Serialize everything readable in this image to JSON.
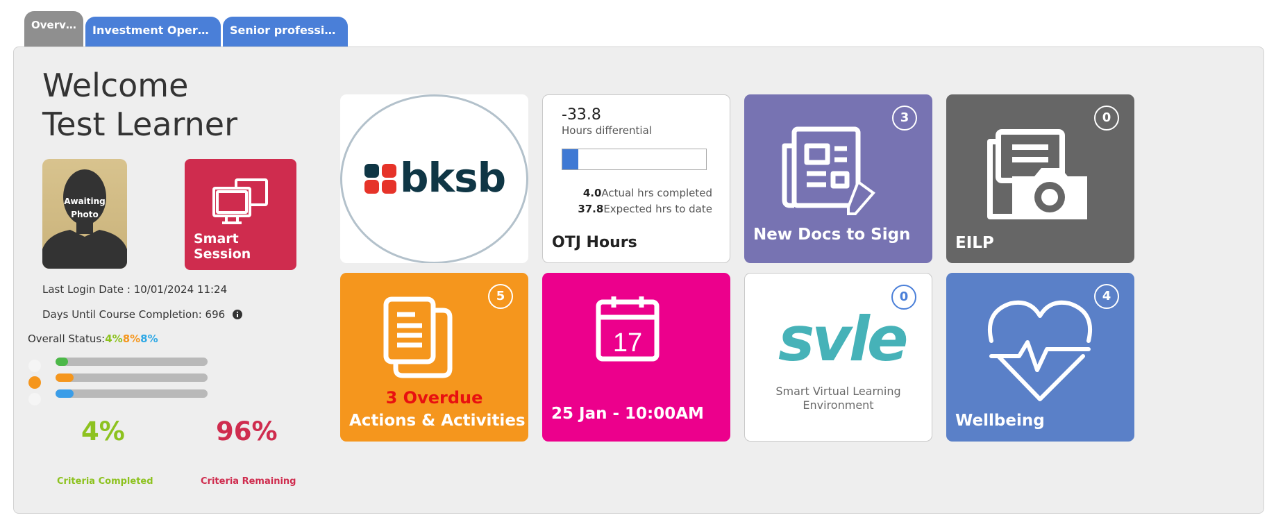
{
  "tabs": [
    {
      "label": "Overview",
      "active": true
    },
    {
      "label": "Investment Operations Specialist",
      "active": false
    },
    {
      "label": "Senior professional in Finance",
      "active": false
    }
  ],
  "welcome": {
    "line1": "Welcome",
    "line2": "Test Learner"
  },
  "photo": {
    "line1": "Awaiting",
    "line2": "Photo"
  },
  "smart_session": {
    "label": "Smart Session",
    "icon": "monitors-icon",
    "color": "#cf2c4e"
  },
  "info": {
    "last_login": "Last Login Date : 10/01/2024 11:24",
    "days_until": "Days Until Course Completion: 696"
  },
  "status": {
    "label": "Overall Status:",
    "values": [
      {
        "text": "4%",
        "color": "#8dc21f"
      },
      {
        "text": "8%",
        "color": "#f5961d"
      },
      {
        "text": "8%",
        "color": "#2ea8e5"
      }
    ],
    "bars": [
      {
        "percent": 8,
        "color": "#4cb848"
      },
      {
        "percent": 12,
        "color": "#f5961d"
      },
      {
        "percent": 12,
        "color": "#3a9de8"
      }
    ],
    "selected_dot": 1
  },
  "criteria": {
    "completed_pct": "4%",
    "completed_label": "Criteria Completed",
    "completed_color": "#8dc21f",
    "remaining_pct": "96%",
    "remaining_label": "Criteria Remaining",
    "remaining_color": "#cf2c4e"
  },
  "tiles": {
    "bksb": {
      "logo_text": "bksb"
    },
    "otj": {
      "differential": "-33.8",
      "differential_label": "Hours differential",
      "progress_fraction": 0.11,
      "actual_value": "4.0",
      "actual_label": "Actual hrs completed",
      "expected_value": "37.8",
      "expected_label": "Expected hrs to date",
      "title": "OTJ Hours"
    },
    "docs": {
      "title": "New Docs to Sign",
      "badge": "3",
      "color": "#7773b2",
      "icon": "document-sign-icon"
    },
    "eilp": {
      "title": "EILP",
      "badge": "0",
      "color": "#666666",
      "icon": "camera-document-icon"
    },
    "actions": {
      "overdue": "3 Overdue",
      "title": "Actions & Activities",
      "badge": "5",
      "color": "#f5961d",
      "icon": "documents-icon"
    },
    "calendar": {
      "title": "25 Jan - 10:00AM",
      "day": "17",
      "color": "#ec008c",
      "icon": "calendar-icon"
    },
    "svle": {
      "logo_text": "svle",
      "line1": "Smart Virtual Learning",
      "line2": "Environment",
      "badge": "0"
    },
    "wellbeing": {
      "title": "Wellbeing",
      "badge": "4",
      "color": "#5a80c8",
      "icon": "heart-pulse-icon"
    }
  }
}
